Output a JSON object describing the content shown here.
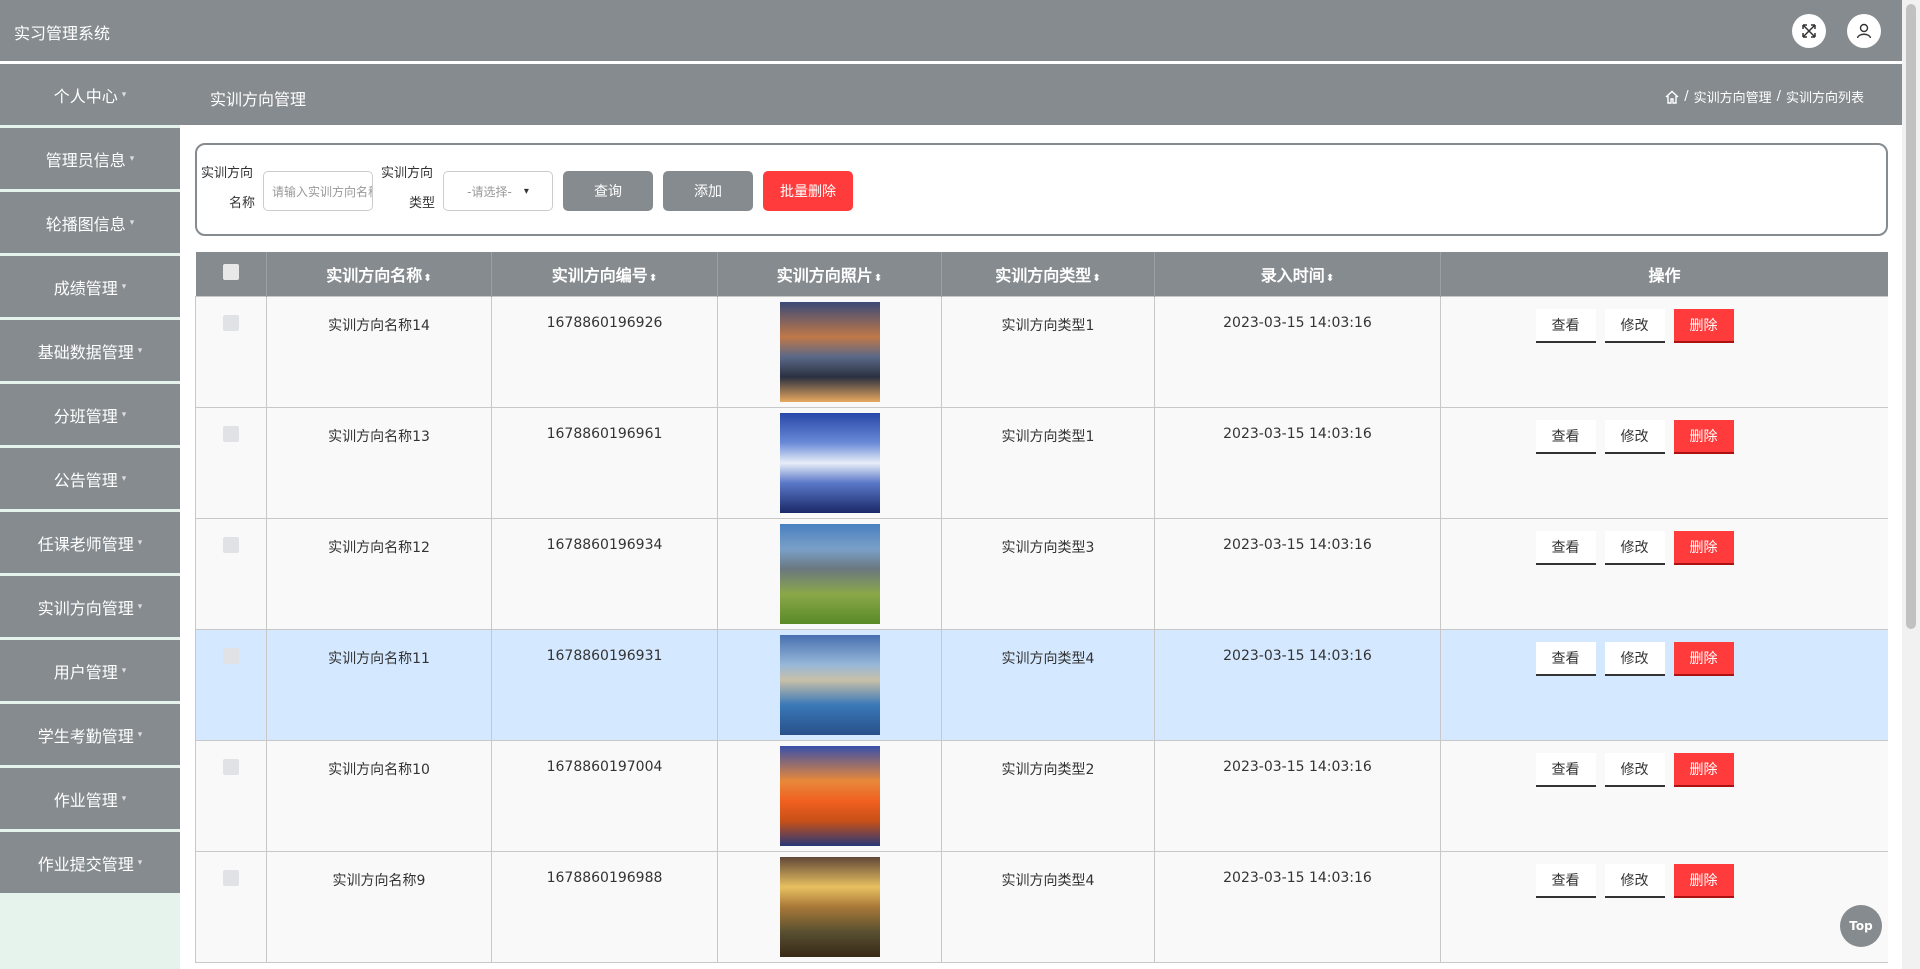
{
  "app": {
    "title": "实习管理系统"
  },
  "sidebar": {
    "items": [
      {
        "label": "个人中心"
      },
      {
        "label": "管理员信息"
      },
      {
        "label": "轮播图信息"
      },
      {
        "label": "成绩管理"
      },
      {
        "label": "基础数据管理"
      },
      {
        "label": "分班管理"
      },
      {
        "label": "公告管理"
      },
      {
        "label": "任课老师管理"
      },
      {
        "label": "实训方向管理"
      },
      {
        "label": "用户管理"
      },
      {
        "label": "学生考勤管理"
      },
      {
        "label": "作业管理"
      },
      {
        "label": "作业提交管理"
      }
    ]
  },
  "header": {
    "page_title": "实训方向管理",
    "breadcrumb": [
      "实训方向管理",
      "实训方向列表"
    ],
    "separator": "/"
  },
  "search": {
    "name_label_1": "实训方向",
    "name_label_2": "名称",
    "name_placeholder": "请输入实训方向名称",
    "type_label_1": "实训方向",
    "type_label_2": "类型",
    "type_select_value": "-请选择-",
    "query_button": "查询",
    "add_button": "添加",
    "batch_delete_button": "批量删除"
  },
  "table": {
    "columns": [
      "实训方向名称",
      "实训方向编号",
      "实训方向照片",
      "实训方向类型",
      "录入时间",
      "操作"
    ],
    "sort_glyph": "⬍",
    "actions": {
      "view": "查看",
      "edit": "修改",
      "delete": "删除"
    },
    "rows": [
      {
        "name": "实训方向名称14",
        "code": "1678860196926",
        "type": "实训方向类型1",
        "time": "2023-03-15 14:03:16"
      },
      {
        "name": "实训方向名称13",
        "code": "1678860196961",
        "type": "实训方向类型1",
        "time": "2023-03-15 14:03:16"
      },
      {
        "name": "实训方向名称12",
        "code": "1678860196934",
        "type": "实训方向类型3",
        "time": "2023-03-15 14:03:16"
      },
      {
        "name": "实训方向名称11",
        "code": "1678860196931",
        "type": "实训方向类型4",
        "time": "2023-03-15 14:03:16"
      },
      {
        "name": "实训方向名称10",
        "code": "1678860197004",
        "type": "实训方向类型2",
        "time": "2023-03-15 14:03:16"
      },
      {
        "name": "实训方向名称9",
        "code": "1678860196988",
        "type": "实训方向类型4",
        "time": "2023-03-15 14:03:16"
      }
    ]
  },
  "top_button": "Top",
  "colors": {
    "primary": "#858b8f",
    "danger": "#ff3b3b",
    "selected_row": "#d4e8ff"
  }
}
